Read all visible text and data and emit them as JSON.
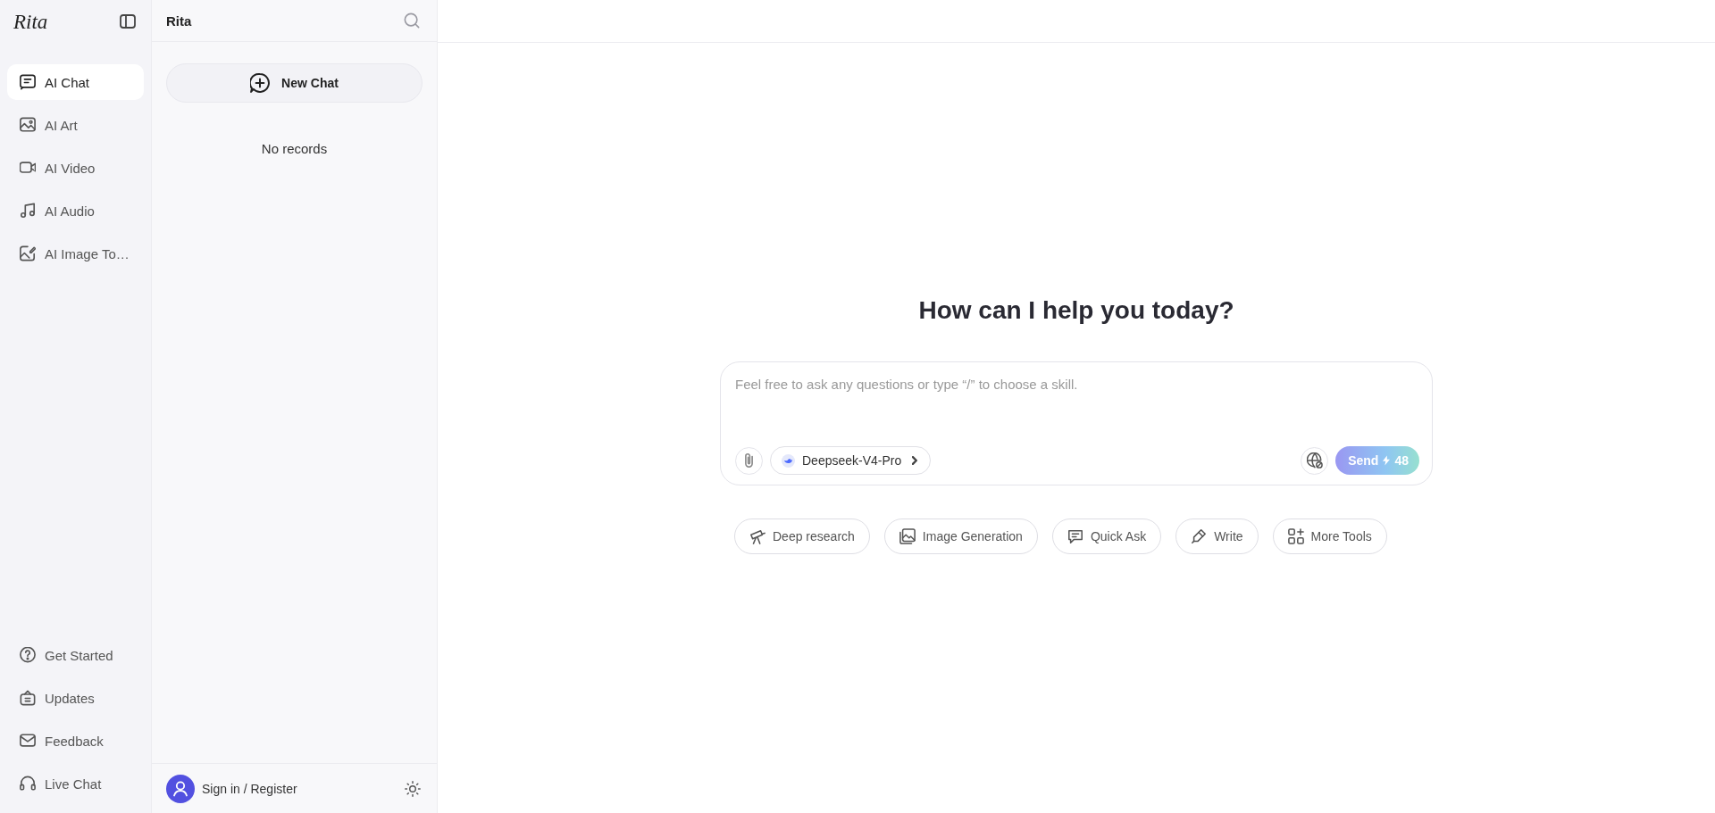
{
  "sidebar": {
    "logo": "Rita",
    "nav_items": [
      {
        "label": "AI Chat",
        "selected": true
      },
      {
        "label": "AI Art",
        "selected": false
      },
      {
        "label": "AI Video",
        "selected": false
      },
      {
        "label": "AI Audio",
        "selected": false
      },
      {
        "label": "AI Image To…",
        "selected": false
      }
    ],
    "bottom_items": [
      {
        "label": "Get Started"
      },
      {
        "label": "Updates"
      },
      {
        "label": "Feedback"
      },
      {
        "label": "Live Chat"
      }
    ]
  },
  "history_panel": {
    "title": "Rita",
    "new_chat": "New Chat",
    "empty_text": "No records",
    "account": "Sign in / Register"
  },
  "main": {
    "heading": "How can I help you today?",
    "composer": {
      "placeholder": "Feel free to ask any questions or type “/” to choose a skill.",
      "model": "Deepseek-V4-Pro",
      "send": "Send",
      "credits": "48"
    },
    "tools": [
      {
        "label": "Deep research"
      },
      {
        "label": "Image Generation"
      },
      {
        "label": "Quick Ask"
      },
      {
        "label": "Write"
      },
      {
        "label": "More Tools"
      }
    ]
  }
}
